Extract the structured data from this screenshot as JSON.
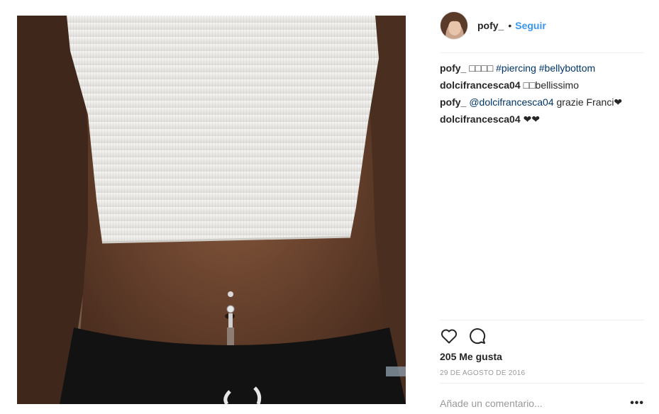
{
  "post": {
    "username": "pofy_",
    "separator": "•",
    "follow_label": "Seguir",
    "likes_text": "205 Me gusta",
    "date_text": "29 DE AGOSTO DE 2016",
    "comment_placeholder": "Añade un comentario...",
    "more_label": "•••"
  },
  "comments": [
    {
      "author": "pofy_",
      "text": "□□□□",
      "hashtags": "#piercing #bellybottom"
    },
    {
      "author": "dolcifrancesca04",
      "text": "□□bellissimo"
    },
    {
      "author": "pofy_",
      "mention": "@dolcifrancesca04",
      "text": "grazie Franci❤"
    },
    {
      "author": "dolcifrancesca04",
      "text": "❤❤"
    }
  ],
  "icons": {
    "like": "heart-icon",
    "comment": "speech-bubble-icon",
    "options": "more-options-icon"
  },
  "colors": {
    "accent": "#3897f0",
    "text": "#262626",
    "muted": "#999999",
    "link": "#003569"
  }
}
